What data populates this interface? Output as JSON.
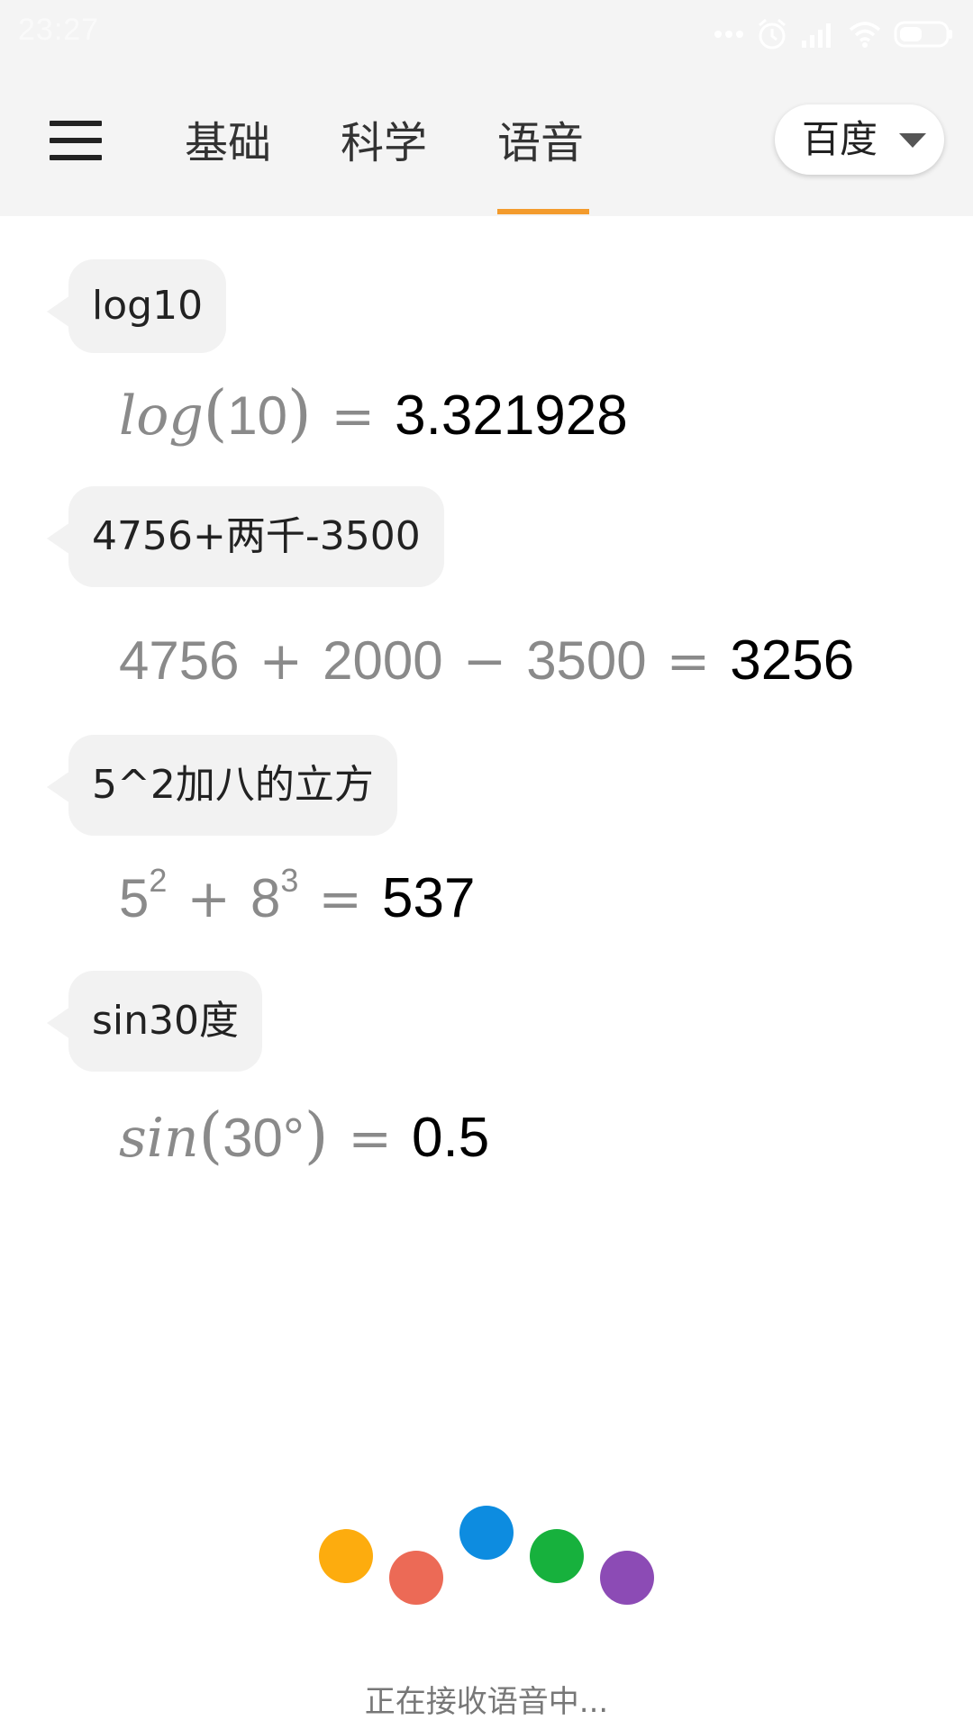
{
  "status_bar": {
    "time": "23:27",
    "icons": [
      "more-dots-icon",
      "alarm-icon",
      "signal-icon",
      "wifi-icon",
      "battery-icon"
    ]
  },
  "header": {
    "menu_icon": "hamburger-menu-icon",
    "tabs": [
      {
        "label": "基础",
        "active": false
      },
      {
        "label": "科学",
        "active": false
      },
      {
        "label": "语音",
        "active": true
      }
    ],
    "engine": {
      "selected": "百度"
    },
    "accent_color": "#f39b2d"
  },
  "chat": [
    {
      "query": "log10",
      "expression": {
        "func": "log",
        "open": "(",
        "arg": "10",
        "close": ")",
        "eq": "="
      },
      "result": "3.321928"
    },
    {
      "query": "4756+两千-3500",
      "expression": {
        "a": "4756",
        "op1": "+",
        "b": "2000",
        "op2": "−",
        "c": "3500",
        "eq": "="
      },
      "result": "3256"
    },
    {
      "query": "5^2加八的立方",
      "expression": {
        "base1": "5",
        "exp1": "2",
        "op": "+",
        "base2": "8",
        "exp2": "3",
        "eq": "="
      },
      "result": "537"
    },
    {
      "query": "sin30度",
      "expression": {
        "func": "sin",
        "open": "(",
        "arg": "30°",
        "close": ")",
        "eq": "="
      },
      "result": "0.5"
    }
  ],
  "voice": {
    "dot_colors": [
      "#fdac0e",
      "#ec6a56",
      "#0d8ce0",
      "#17b13d",
      "#8c4bb5"
    ],
    "status_text": "正在接收语音中..."
  }
}
